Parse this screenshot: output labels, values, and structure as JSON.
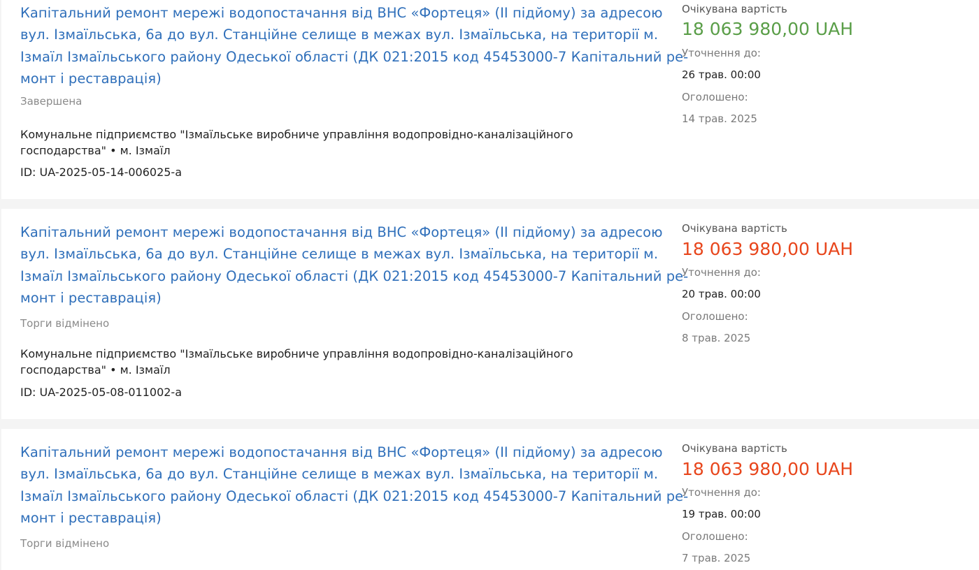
{
  "colors": {
    "link": "#2f6fba",
    "amount_complete": "#5a9e48",
    "amount_cancelled": "#e8461c",
    "muted": "#8a8a8a",
    "text": "#222222",
    "background": "#f4f4f4",
    "card": "#ffffff"
  },
  "labels": {
    "expected_cost": "Очікувана вартість",
    "clarify_until": "Уточнення до:",
    "announced": "Оголошено:"
  },
  "tenders": [
    {
      "title_lines": [
        "Капітальний ремонт мережі водопостачання від ВНС «Фортеця» (ІІ підйому) за адресою",
        "вул. Ізмаїльська, 6а до вул. Станційне селище в межах вул. Ізмаїльська, на території м.",
        "Ізмаїл Ізмаїльського району Одеської області (ДК 021:2015 код 45453000-7 Капітальний ре-",
        "монт і реставрація)"
      ],
      "status": "Завершена",
      "org_lines": [
        "Комунальне підприємство \"Ізмаїльське виробниче управління водопровідно-каналізаційного",
        "господарства\" • м. Ізмаїл"
      ],
      "id": "ID: UA-2025-05-14-006025-a",
      "amount": "18 063 980,00 UAH",
      "amount_color": "#5a9e48",
      "clarify_until": "26 трав. 00:00",
      "announced": "14 трав. 2025"
    },
    {
      "title_lines": [
        "Капітальний ремонт мережі водопостачання від ВНС «Фортеця» (ІІ підйому) за адресою",
        "вул. Ізмаїльська, 6а до вул. Станційне селище в межах вул. Ізмаїльська, на території м.",
        "Ізмаїл Ізмаїльського району Одеської області (ДК 021:2015 код 45453000-7 Капітальний ре-",
        "монт і реставрація)"
      ],
      "status": "Торги відмінено",
      "org_lines": [
        "Комунальне підприємство \"Ізмаїльське виробниче управління водопровідно-каналізаційного",
        "господарства\" • м. Ізмаїл"
      ],
      "id": "ID: UA-2025-05-08-011002-a",
      "amount": "18 063 980,00 UAH",
      "amount_color": "#e8461c",
      "clarify_until": "20 трав. 00:00",
      "announced": "8 трав. 2025"
    },
    {
      "title_lines": [
        "Капітальний ремонт мережі водопостачання від ВНС «Фортеця» (ІІ підйому) за адресою",
        "вул. Ізмаїльська, 6а до вул. Станційне селище в межах вул. Ізмаїльська, на території м.",
        "Ізмаїл Ізмаїльського району Одеської області (ДК 021:2015 код 45453000-7 Капітальний ре-",
        "монт і реставрація)"
      ],
      "status": "Торги відмінено",
      "amount": "18 063 980,00 UAH",
      "amount_color": "#e8461c",
      "clarify_until": "19 трав. 00:00",
      "announced": "7 трав. 2025"
    }
  ]
}
